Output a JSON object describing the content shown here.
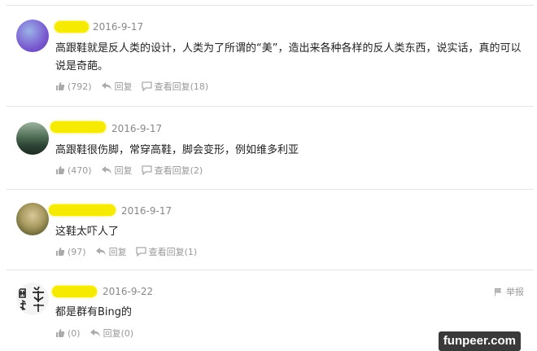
{
  "comments": [
    {
      "date": "2016-9-17",
      "text": "高跟鞋就是反人类的设计，人类为了所谓的“美”，造出来各种各样的反人类东西，说实话，真的可以说是奇葩。",
      "likes": "(792)",
      "reply_label": "回复",
      "view_replies": "查看回复(18)"
    },
    {
      "date": "2016-9-17",
      "text": "高跟鞋很伤脚，常穿高鞋，脚会变形，例如维多利亚",
      "likes": "(470)",
      "reply_label": "回复",
      "view_replies": "查看回复(2)"
    },
    {
      "date": "2016-9-17",
      "text": "这鞋太吓人了",
      "likes": "(97)",
      "reply_label": "回复",
      "view_replies": "查看回复(1)"
    },
    {
      "date": "2016-9-22",
      "text": "都是群有Bing的",
      "likes": "(0)",
      "reply_label": "回复(0)",
      "report_label": "举报"
    }
  ],
  "watermark": "funpeer.com",
  "colors": {
    "highlight": "#f5ea00",
    "divider": "#e6e6e6",
    "muted": "#999999"
  }
}
